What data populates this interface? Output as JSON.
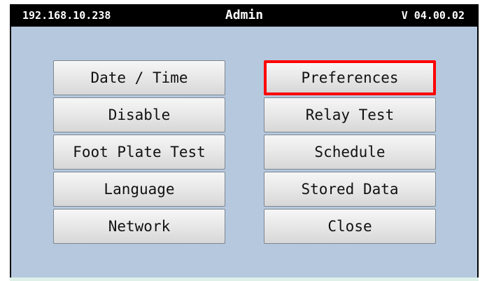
{
  "header": {
    "ip": "192.168.10.238",
    "title": "Admin",
    "version": "V 04.00.02"
  },
  "menu": {
    "left": [
      "Date / Time",
      "Disable",
      "Foot Plate Test",
      "Language",
      "Network"
    ],
    "right": [
      "Preferences",
      "Relay Test",
      "Schedule",
      "Stored Data",
      "Close"
    ],
    "selected": "Preferences",
    "selected_color": "#ff0000"
  },
  "colors": {
    "header_bg": "#000000",
    "panel_bg": "#b5c8de"
  }
}
